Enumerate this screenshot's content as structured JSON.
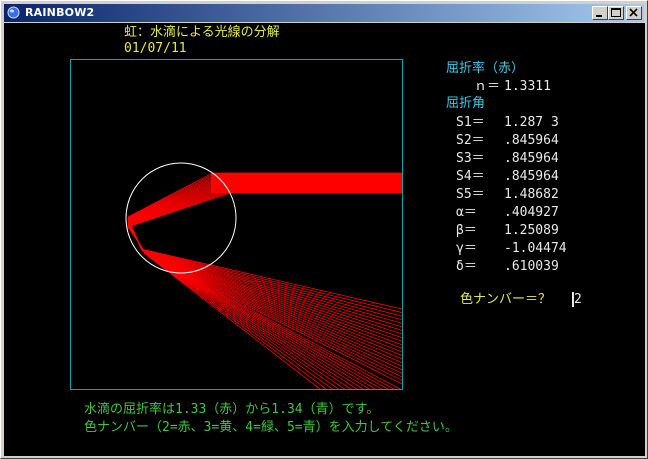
{
  "window": {
    "title": "RAINBOW2"
  },
  "header": {
    "title": "虹：水滴による光線の分解",
    "date": "01/07/11"
  },
  "refraction": {
    "label": "屈折率（赤）",
    "n_label": "ｎ＝",
    "n_value": "1.3311"
  },
  "angles": {
    "label": "屈折角",
    "rows": [
      {
        "name": "S1＝",
        "value": "1.287 3"
      },
      {
        "name": "S2＝",
        "value": ".845964"
      },
      {
        "name": "S3＝",
        "value": ".845964"
      },
      {
        "name": "S4＝",
        "value": ".845964"
      },
      {
        "name": "S5＝",
        "value": "1.48682"
      },
      {
        "name": "α＝",
        "value": ".404927"
      },
      {
        "name": "β＝",
        "value": "1.25089"
      },
      {
        "name": "γ＝",
        "value": "-1.04474"
      },
      {
        "name": "δ＝",
        "value": ".610039"
      }
    ]
  },
  "prompt": {
    "label": "色ナンバー＝？",
    "input_value": "2"
  },
  "footer": {
    "line1": "水滴の屈折率は1.33（赤）から1.34（青）です。",
    "line2": "色ナンバー（2=赤、3=黄、4=緑、5=青）を入力してください。"
  },
  "colors": {
    "ray": "#ff0000",
    "frame": "#00a8a8",
    "circle": "#ffffff"
  },
  "icons": {
    "app": "globe-icon",
    "minimize": "minimize-icon",
    "maximize": "maximize-icon",
    "close": "close-icon"
  }
}
